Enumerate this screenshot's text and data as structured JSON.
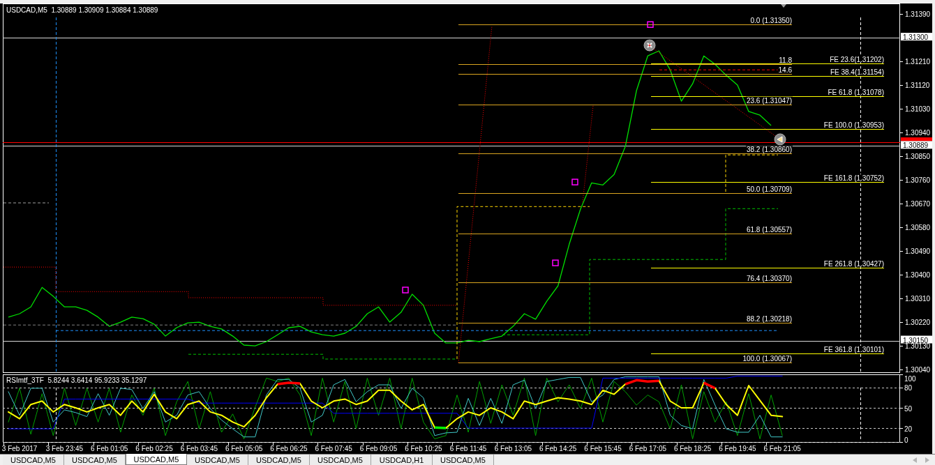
{
  "price_chart": {
    "header": "USDCAD,M5  1.30889 1.30909 1.30884 1.30889",
    "chart_data": {
      "type": "line",
      "categories": [
        null,
        null,
        null,
        null,
        null,
        null,
        null,
        null,
        null,
        null,
        null,
        null,
        null,
        null,
        null,
        null,
        null,
        null,
        null,
        null,
        null,
        null,
        null,
        null,
        null,
        null,
        null,
        null,
        null,
        null,
        null,
        null,
        null,
        null,
        null,
        null,
        null,
        null,
        null,
        null,
        null,
        null,
        null,
        null,
        null,
        null,
        null,
        null,
        null,
        null,
        null,
        null,
        null,
        null,
        null,
        null,
        null,
        null,
        null,
        null,
        null,
        null,
        null,
        null,
        null,
        null,
        null,
        null,
        null,
        null,
        null,
        null,
        null,
        null,
        null,
        null,
        null,
        null,
        null,
        null
      ],
      "series": [
        {
          "color": "#00e000",
          "values": [
            1.30239,
            1.30252,
            1.30278,
            1.30352,
            1.30318,
            1.30278,
            1.30278,
            1.30265,
            1.30239,
            1.30204,
            1.3022,
            1.30239,
            1.30233,
            1.30212,
            1.30167,
            1.30199,
            1.30217,
            1.3022,
            1.30204,
            1.30194,
            1.30167,
            1.30133,
            1.3013,
            1.30146,
            1.30172,
            1.30199,
            1.30204,
            1.30183,
            1.30172,
            1.30167,
            1.30178,
            1.30204,
            1.30252,
            1.30278,
            1.3022,
            1.30257,
            1.30326,
            1.30284,
            1.30178,
            1.30141,
            1.30141,
            1.30151,
            1.30146,
            1.30157,
            1.30167,
            1.30204,
            1.30252,
            1.30231,
            1.30299,
            1.30358,
            1.30516,
            1.30649,
            1.30749,
            1.30741,
            1.30781,
            1.30887,
            1.31099,
            1.31231,
            1.3125,
            1.31178,
            1.31059,
            1.31125,
            1.31231,
            1.31199,
            1.31157,
            1.3112,
            1.3102,
            1.31006,
            1.30967,
            null,
            null,
            null,
            null,
            null,
            null,
            null,
            null,
            null,
            null,
            null
          ]
        }
      ],
      "ylim": [
        1.30027,
        1.3143
      ],
      "yticks": [
        {
          "value": 1.3139,
          "label": "1.31390"
        },
        {
          "value": 1.3121,
          "label": "1.31210"
        },
        {
          "value": 1.3112,
          "label": "1.31120"
        },
        {
          "value": 1.3103,
          "label": "1.31030"
        },
        {
          "value": 1.3094,
          "label": "1.30940"
        },
        {
          "value": 1.3085,
          "label": "1.30850"
        },
        {
          "value": 1.3076,
          "label": "1.30760"
        },
        {
          "value": 1.3067,
          "label": "1.30670"
        },
        {
          "value": 1.3058,
          "label": "1.30580"
        },
        {
          "value": 1.3049,
          "label": "1.30490"
        },
        {
          "value": 1.304,
          "label": "1.30400"
        },
        {
          "value": 1.3031,
          "label": "1.30310"
        },
        {
          "value": 1.3022,
          "label": "1.30220"
        },
        {
          "value": 1.3013,
          "label": "1.30130"
        },
        {
          "value": 1.3004,
          "label": "1.30040"
        }
      ],
      "ref_lines": [
        {
          "axis": "y",
          "value": 1.313,
          "label": "1.31300"
        },
        {
          "axis": "y",
          "value": 1.3015,
          "label": "1.30150"
        },
        {
          "axis": "y",
          "value": 1.30903
        },
        {
          "axis": "y",
          "value": 1.30889,
          "label": "1.30889"
        }
      ]
    },
    "fib_retracement": [
      "0.0 (1.31350)",
      "11.8",
      "14.6",
      "23.6 (1.31047)",
      "38.2 (1.30860)",
      "50.0 (1.30709)",
      "61.8 (1.30557)",
      "76.4 (1.30370)",
      "88.2 (1.30218)",
      "100.0 (1.30067)"
    ],
    "fib_expansion": [
      "FE 23.6(1.31202)",
      "FE 38.4(1.31154)",
      "FE 61.8 (1.31078)",
      "FE 100.0 (1.30953)",
      "FE 161.8 (1.30752)",
      "FE 261.8 (1.30427)",
      "FE 361.8 (1.30101)"
    ]
  },
  "indicator": {
    "chart_data": {
      "type": "line",
      "title": "RSImtf_3TF  5.8244 3.6414 95.9233 35.1297",
      "grid": true,
      "categories": [
        null,
        "3 Feb 2017",
        null,
        null,
        null,
        "3 Feb 23:45",
        null,
        null,
        null,
        "6 Feb 01:05",
        null,
        null,
        null,
        "6 Feb 02:25",
        null,
        null,
        null,
        "6 Feb 03:45",
        null,
        null,
        null,
        "6 Feb 05:05",
        null,
        null,
        null,
        "6 Feb 06:25",
        null,
        null,
        null,
        "6 Feb 07:45",
        null,
        null,
        null,
        "6 Feb 09:05",
        null,
        null,
        null,
        "6 Feb 10:25",
        null,
        null,
        null,
        "6 Feb 11:45",
        null,
        null,
        null,
        "6 Feb 13:05",
        null,
        null,
        null,
        "6 Feb 14:25",
        null,
        null,
        null,
        "6 Feb 15:45",
        null,
        null,
        null,
        "6 Feb 17:05",
        null,
        null,
        null,
        "6 Feb 18:25",
        null,
        null,
        null,
        "6 Feb 19:45",
        null,
        null,
        null,
        "6 Feb 21:05",
        null,
        null,
        null,
        null,
        null,
        null,
        null,
        null,
        null,
        null
      ],
      "series": [
        {
          "color": "#00a000",
          "values": [
            30,
            80,
            12,
            72,
            10,
            80,
            25,
            80,
            30,
            80,
            15,
            70,
            40,
            80,
            10,
            60,
            90,
            20,
            75,
            15,
            42,
            5,
            52,
            95,
            90,
            95,
            70,
            10,
            95,
            30,
            90,
            20,
            95,
            40,
            95,
            20,
            95,
            30,
            5,
            10,
            70,
            15,
            90,
            28,
            85,
            40,
            95,
            10,
            95,
            60,
            85,
            50,
            95,
            30,
            90,
            75,
            55,
            70,
            60,
            20,
            85,
            5,
            75,
            30,
            60,
            10,
            72,
            5,
            70,
            10,
            null,
            null,
            null,
            null,
            null,
            null,
            null,
            null,
            null,
            null
          ]
        },
        {
          "color": "#40c8c8",
          "values": [
            75,
            40,
            80,
            80,
            30,
            48,
            44,
            38,
            72,
            40,
            80,
            78,
            50,
            75,
            30,
            40,
            70,
            75,
            50,
            33,
            20,
            8,
            8,
            70,
            93,
            93,
            80,
            30,
            40,
            85,
            93,
            60,
            75,
            85,
            85,
            50,
            80,
            66,
            10,
            14,
            15,
            65,
            25,
            65,
            28,
            85,
            92,
            50,
            90,
            93,
            96,
            96,
            60,
            70,
            93,
            97,
            97,
            97,
            97,
            40,
            25,
            20,
            93,
            55,
            20,
            15,
            15,
            40,
            8,
            8,
            null,
            null,
            null,
            null,
            null,
            null,
            null,
            null,
            null,
            null
          ]
        },
        {
          "color": "#0000ff",
          "values": [
            20,
            20,
            20,
            20,
            20,
            64,
            64,
            64,
            64,
            64,
            64,
            64,
            64,
            64,
            64,
            64,
            64,
            58,
            58,
            58,
            58,
            58,
            58,
            58,
            58,
            58,
            58,
            58,
            58,
            43,
            43,
            43,
            43,
            43,
            43,
            43,
            43,
            43,
            43,
            43,
            43,
            21,
            21,
            21,
            21,
            21,
            21,
            21,
            21,
            21,
            21,
            21,
            21,
            95,
            95,
            95,
            95,
            95,
            95,
            95,
            95,
            95,
            95,
            95,
            95,
            98,
            98,
            98,
            98,
            98,
            null,
            null,
            null,
            null,
            null,
            null,
            null,
            null,
            null,
            null
          ]
        },
        {
          "color": "#ffff00",
          "values": [
            45,
            35,
            56,
            61,
            45,
            56,
            51,
            45,
            51,
            56,
            40,
            61,
            45,
            71,
            45,
            35,
            56,
            61,
            45,
            40,
            30,
            23,
            40,
            66,
            86,
            null,
            87,
            61,
            51,
            61,
            64,
            56,
            61,
            77,
            77,
            61,
            48,
            56,
            22,
            21,
            35,
            45,
            40,
            51,
            45,
            35,
            61,
            56,
            61,
            66,
            64,
            61,
            56,
            77,
            71,
            86,
            null,
            null,
            91,
            61,
            51,
            51,
            88,
            80,
            56,
            40,
            84,
            62,
            40,
            38,
            null,
            null,
            null,
            null,
            null,
            null,
            null,
            null,
            null,
            null
          ]
        },
        {
          "color": "#ff0000",
          "values": [
            null,
            null,
            null,
            null,
            null,
            null,
            null,
            null,
            null,
            null,
            null,
            null,
            null,
            null,
            null,
            null,
            null,
            null,
            null,
            null,
            null,
            null,
            null,
            null,
            86,
            88,
            87,
            null,
            null,
            null,
            null,
            null,
            null,
            null,
            null,
            null,
            null,
            null,
            null,
            null,
            null,
            null,
            null,
            null,
            null,
            null,
            null,
            null,
            null,
            null,
            null,
            null,
            null,
            null,
            null,
            86,
            92,
            90,
            91,
            null,
            null,
            null,
            88,
            80,
            null,
            null,
            null,
            null,
            null,
            null,
            null,
            null,
            null,
            null,
            null,
            null,
            null,
            null,
            null,
            null
          ]
        },
        {
          "color": "#00ff00",
          "values": [
            null,
            null,
            null,
            null,
            null,
            null,
            null,
            null,
            null,
            null,
            null,
            null,
            null,
            null,
            null,
            null,
            null,
            null,
            null,
            null,
            null,
            null,
            null,
            null,
            null,
            null,
            null,
            null,
            null,
            null,
            null,
            null,
            null,
            null,
            null,
            null,
            null,
            null,
            22,
            21,
            null,
            null,
            null,
            null,
            null,
            null,
            null,
            null,
            null,
            null,
            null,
            null,
            null,
            null,
            null,
            null,
            null,
            null,
            null,
            null,
            null,
            null,
            null,
            null,
            null,
            null,
            null,
            null,
            null,
            null,
            null,
            null,
            null,
            null,
            null,
            null,
            null,
            null,
            null,
            null
          ]
        }
      ],
      "ylim": [
        0,
        100
      ],
      "yticks": [
        0,
        20,
        50,
        80,
        100
      ]
    }
  },
  "tabs": [
    {
      "label": "USDCAD,M5",
      "selected": false
    },
    {
      "label": "USDCAD,M5",
      "selected": false
    },
    {
      "label": "USDCAD,M5",
      "selected": true
    },
    {
      "label": "USDCAD,M5",
      "selected": false
    },
    {
      "label": "USDCAD,M5",
      "selected": false
    },
    {
      "label": "USDCAD,M5",
      "selected": false
    },
    {
      "label": "USDCAD,H1",
      "selected": false
    },
    {
      "label": "USDCAD,M5",
      "selected": false
    }
  ],
  "tab_scroll": [
    {
      "kind": "left",
      "disabled": true
    },
    {
      "kind": "right",
      "disabled": true
    }
  ]
}
